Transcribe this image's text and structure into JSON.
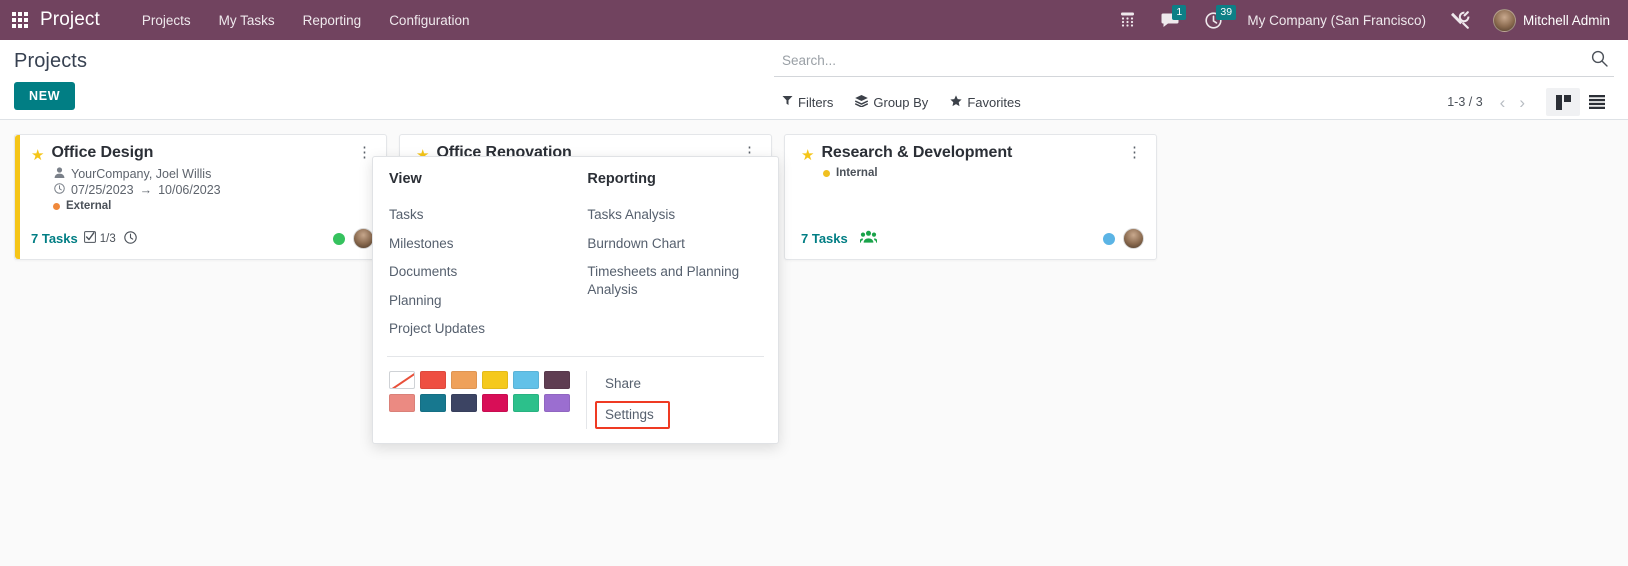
{
  "navbar": {
    "apps_icon": "apps-grid-icon",
    "brand": "Project",
    "menu": [
      {
        "label": "Projects"
      },
      {
        "label": "My Tasks"
      },
      {
        "label": "Reporting"
      },
      {
        "label": "Configuration"
      }
    ],
    "right": {
      "voip_icon": "telephone-keypad-icon",
      "messages_icon": "chat-bubble-icon",
      "messages_badge": "1",
      "activities_icon": "clock-icon",
      "activities_badge": "39",
      "company": "My Company (San Francisco)",
      "debug_icon": "tools-wrench-icon",
      "avatar_icon": "user-avatar",
      "user_name": "Mitchell Admin"
    },
    "background_color": "#71435f",
    "badge_color": "#0d7f86"
  },
  "control_panel": {
    "page_title": "Projects",
    "new_button": "NEW",
    "new_button_color": "#017e84",
    "search": {
      "placeholder": "Search...",
      "value": "",
      "icon": "search-icon"
    },
    "filters": [
      {
        "label": "Filters",
        "icon": "funnel-icon"
      },
      {
        "label": "Group By",
        "icon": "layers-icon"
      },
      {
        "label": "Favorites",
        "icon": "star-icon"
      }
    ],
    "pager": {
      "text": "1-3 / 3",
      "prev_icon": "chevron-left-icon",
      "next_icon": "chevron-right-icon"
    },
    "views": [
      {
        "name": "kanban",
        "icon": "kanban-view-icon",
        "active": true
      },
      {
        "name": "list",
        "icon": "list-view-icon",
        "active": false
      }
    ]
  },
  "kanban": {
    "cards": [
      {
        "title": "Office Design",
        "star_icon": "star-icon",
        "menu_icon": "vertical-dots-icon",
        "stripe_color": "#f5c518",
        "customer_icon": "person-icon",
        "customer": "YourCompany, Joel Willis",
        "date_icon": "clock-icon",
        "date_start": "07/25/2023",
        "date_arrow": "→",
        "date_end": "10/06/2023",
        "tag_label": "External",
        "tag_color": "#f0893b",
        "tasks_label": "7 Tasks",
        "check_icon": "checkbox-icon",
        "milestone_count": "1/3",
        "clock_icon": "clock-icon",
        "status_dot_color": "#35c25e",
        "avatar_icon": "user-avatar"
      },
      {
        "title": "Office Renovation",
        "star_icon": "star-icon",
        "menu_icon": "vertical-dots-icon",
        "stripe_color": "transparent"
      },
      {
        "title": "Research & Development",
        "star_icon": "star-icon",
        "menu_icon": "vertical-dots-icon",
        "stripe_color": "transparent",
        "tag_label": "Internal",
        "tag_color": "#f0c020",
        "tasks_label": "7 Tasks",
        "users_icon": "users-group-icon",
        "status_dot_color": "#5bb4e5",
        "avatar_icon": "user-avatar"
      }
    ]
  },
  "dropdown": {
    "view_header": "View",
    "view_items": [
      {
        "label": "Tasks"
      },
      {
        "label": "Milestones"
      },
      {
        "label": "Documents"
      },
      {
        "label": "Planning"
      },
      {
        "label": "Project Updates"
      }
    ],
    "reporting_header": "Reporting",
    "reporting_items": [
      {
        "label": "Tasks Analysis"
      },
      {
        "label": "Burndown Chart"
      },
      {
        "label": "Timesheets and Planning Analysis"
      }
    ],
    "colors_row1": [
      {
        "name": "no-color",
        "hex": "#ffffff"
      },
      {
        "name": "red",
        "hex": "#ee4f42"
      },
      {
        "name": "orange",
        "hex": "#efa15a"
      },
      {
        "name": "yellow",
        "hex": "#f5c91c"
      },
      {
        "name": "light-blue",
        "hex": "#62c1e8"
      },
      {
        "name": "dark-purple",
        "hex": "#5f3d52"
      }
    ],
    "colors_row2": [
      {
        "name": "salmon",
        "hex": "#eb8a82"
      },
      {
        "name": "teal",
        "hex": "#17788f"
      },
      {
        "name": "navy",
        "hex": "#3c4463"
      },
      {
        "name": "magenta",
        "hex": "#d80e57"
      },
      {
        "name": "green",
        "hex": "#2cc08b"
      },
      {
        "name": "purple",
        "hex": "#9b6ed0"
      }
    ],
    "actions": [
      {
        "label": "Share",
        "highlighted": false
      },
      {
        "label": "Settings",
        "highlighted": true
      }
    ],
    "highlight_color": "#ef3a23"
  }
}
